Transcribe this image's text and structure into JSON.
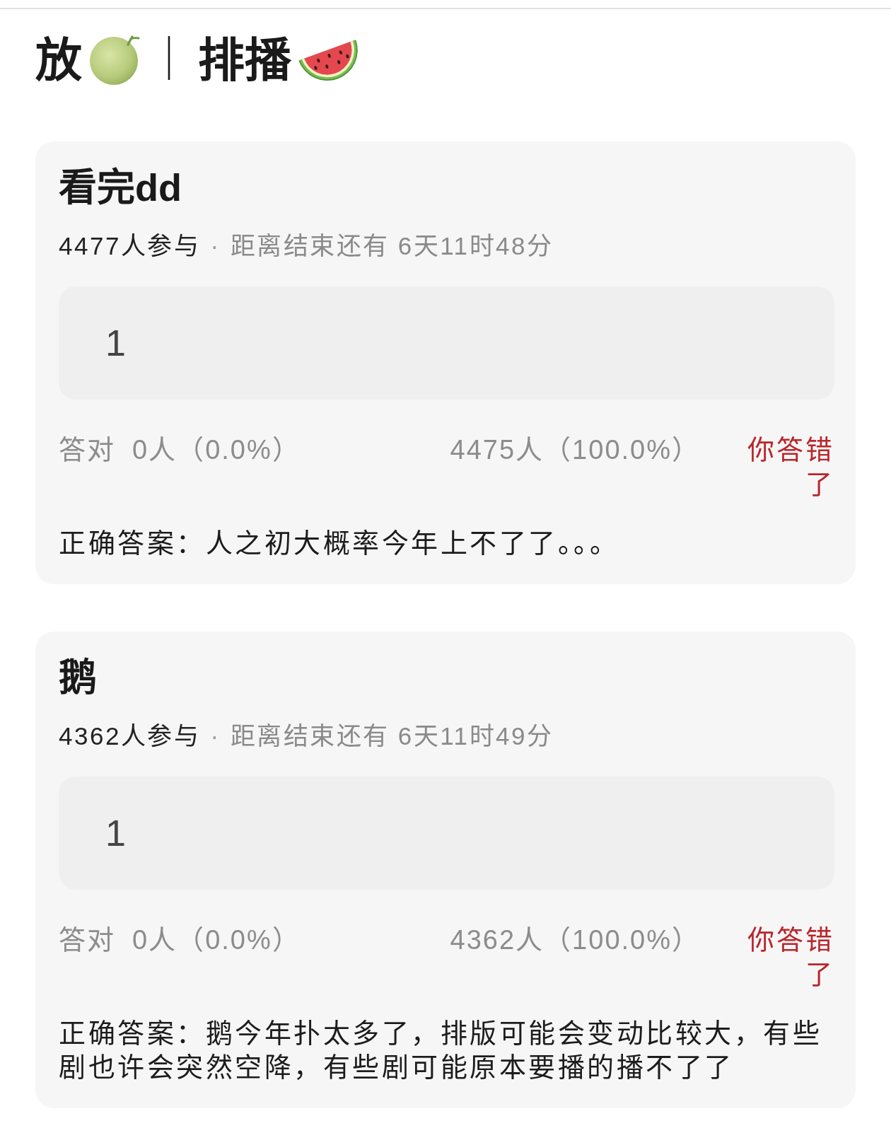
{
  "header": {
    "left": "放",
    "separator": "｜",
    "right": "排播"
  },
  "cards": [
    {
      "title": "看完dd",
      "participants": "4477人参与",
      "separator": "·",
      "countdown": "距离结束还有 6天11时48分",
      "answer": "1",
      "correct_label": "答对",
      "correct_count": "0人（0.0%）",
      "wrong_count": "4475人（100.0%）",
      "verdict": {
        "text": "你答错了",
        "correct": false
      },
      "solution": "正确答案：人之初大概率今年上不了了。。。"
    },
    {
      "title": "鹅",
      "participants": "4362人参与",
      "separator": "·",
      "countdown": "距离结束还有 6天11时49分",
      "answer": "1",
      "correct_label": "答对",
      "correct_count": "0人（0.0%）",
      "wrong_count": "4362人（100.0%）",
      "verdict": {
        "text": "你答错了",
        "correct": false
      },
      "solution": "正确答案：鹅今年扑太多了，排版可能会变动比较大，有些剧也许会突然空降，有些剧可能原本要播的播不了了"
    }
  ]
}
